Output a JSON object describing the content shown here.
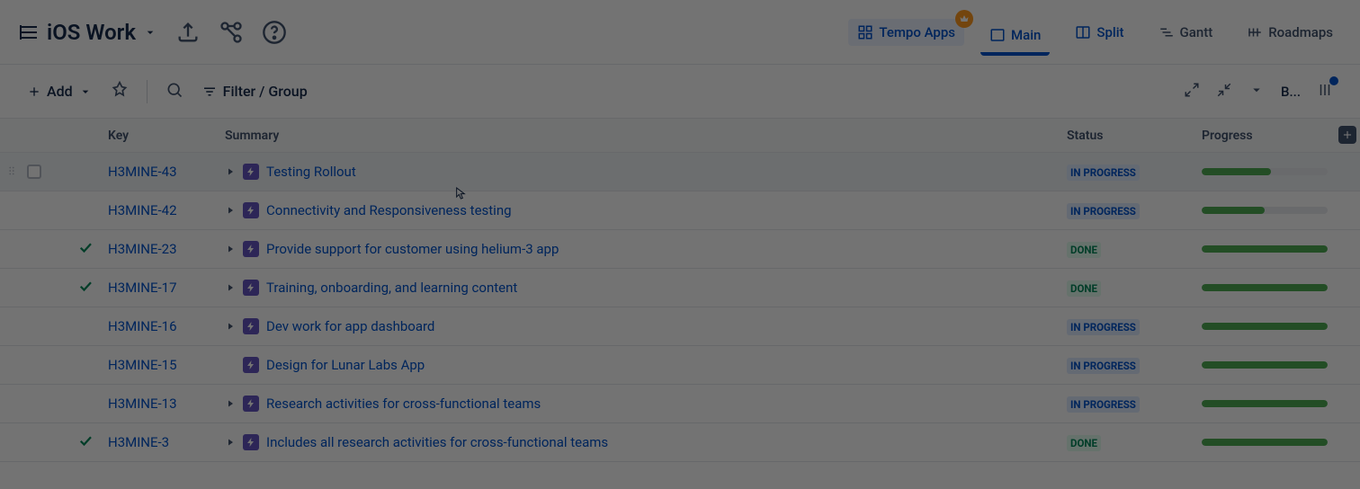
{
  "header": {
    "title": "iOS Work",
    "view_tabs": {
      "tempo": "Tempo Apps",
      "main": "Main",
      "split": "Split",
      "gantt": "Gantt",
      "roadmaps": "Roadmaps"
    }
  },
  "toolbar": {
    "add": "Add",
    "filter": "Filter / Group",
    "b": "B..."
  },
  "columns": {
    "key": "Key",
    "summary": "Summary",
    "status": "Status",
    "progress": "Progress"
  },
  "status_labels": {
    "in_progress": "IN PROGRESS",
    "done": "DONE"
  },
  "rows": [
    {
      "key": "H3MINE-43",
      "summary": "Testing Rollout",
      "status": "in_progress",
      "progress_pct": 55,
      "expandable": true,
      "hovered": true
    },
    {
      "key": "H3MINE-42",
      "summary": "Connectivity and Responsiveness testing",
      "status": "in_progress",
      "progress_pct": 50,
      "expandable": true
    },
    {
      "key": "H3MINE-23",
      "summary": "Provide support for customer using helium-3 app",
      "status": "done",
      "progress_pct": 100,
      "expandable": true,
      "done": true
    },
    {
      "key": "H3MINE-17",
      "summary": "Training, onboarding, and learning content",
      "status": "done",
      "progress_pct": 100,
      "expandable": true,
      "done": true
    },
    {
      "key": "H3MINE-16",
      "summary": "Dev work for app dashboard",
      "status": "in_progress",
      "progress_pct": 100,
      "expandable": true
    },
    {
      "key": "H3MINE-15",
      "summary": "Design for Lunar Labs App",
      "status": "in_progress",
      "progress_pct": 100,
      "expandable": false
    },
    {
      "key": "H3MINE-13",
      "summary": "Research activities for cross-functional teams",
      "status": "in_progress",
      "progress_pct": 100,
      "expandable": true
    },
    {
      "key": "H3MINE-3",
      "summary": "Includes all research activities for cross-functional teams",
      "status": "done",
      "progress_pct": 100,
      "expandable": true,
      "done": true
    }
  ]
}
